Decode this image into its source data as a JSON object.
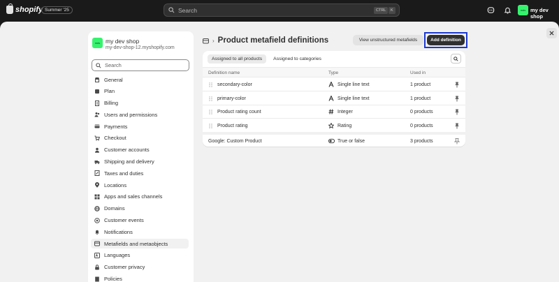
{
  "topbar": {
    "brand": "shopify",
    "edition": "Summer '25",
    "search_placeholder": "Search",
    "shortcut_ctrl": "CTRL",
    "shortcut_key": "K",
    "store_badge": "mds",
    "store_name": "my dev shop"
  },
  "sidebar": {
    "shop_badge": "mds",
    "shop_name": "my dev shop",
    "shop_url": "my-dev-shop-12.myshopify.com",
    "search_placeholder": "Search",
    "items": [
      {
        "label": "General",
        "icon": "store-icon"
      },
      {
        "label": "Plan",
        "icon": "plan-icon"
      },
      {
        "label": "Billing",
        "icon": "billing-icon"
      },
      {
        "label": "Users and permissions",
        "icon": "users-icon"
      },
      {
        "label": "Payments",
        "icon": "payments-icon"
      },
      {
        "label": "Checkout",
        "icon": "cart-icon"
      },
      {
        "label": "Customer accounts",
        "icon": "person-icon"
      },
      {
        "label": "Shipping and delivery",
        "icon": "truck-icon"
      },
      {
        "label": "Taxes and duties",
        "icon": "tax-icon"
      },
      {
        "label": "Locations",
        "icon": "location-icon"
      },
      {
        "label": "Apps and sales channels",
        "icon": "apps-icon"
      },
      {
        "label": "Domains",
        "icon": "globe-icon"
      },
      {
        "label": "Customer events",
        "icon": "events-icon"
      },
      {
        "label": "Notifications",
        "icon": "bell-icon"
      },
      {
        "label": "Metafields and metaobjects",
        "icon": "metafields-icon",
        "active": true
      },
      {
        "label": "Languages",
        "icon": "languages-icon"
      },
      {
        "label": "Customer privacy",
        "icon": "lock-icon"
      },
      {
        "label": "Policies",
        "icon": "policies-icon"
      }
    ]
  },
  "content": {
    "title": "Product metafield definitions",
    "view_unstructured": "View unstructured metafields",
    "add_definition": "Add definition",
    "tabs": [
      "Assigned to all products",
      "Assigned to categories"
    ],
    "columns": [
      "Definition name",
      "Type",
      "Used in"
    ],
    "rows": [
      {
        "name": "secondary-color",
        "type": "Single line text",
        "type_icon": "text-icon",
        "used": "1 product"
      },
      {
        "name": "primary-color",
        "type": "Single line text",
        "type_icon": "text-icon",
        "used": "1 product"
      },
      {
        "name": "Product rating count",
        "type": "Integer",
        "type_icon": "hash-icon",
        "used": "0 products"
      },
      {
        "name": "Product rating",
        "type": "Rating",
        "type_icon": "star-icon",
        "used": "0 products"
      }
    ],
    "google_row": {
      "name": "Google: Custom Product",
      "type": "True or false",
      "type_icon": "toggle-icon",
      "used": "3 products"
    }
  }
}
